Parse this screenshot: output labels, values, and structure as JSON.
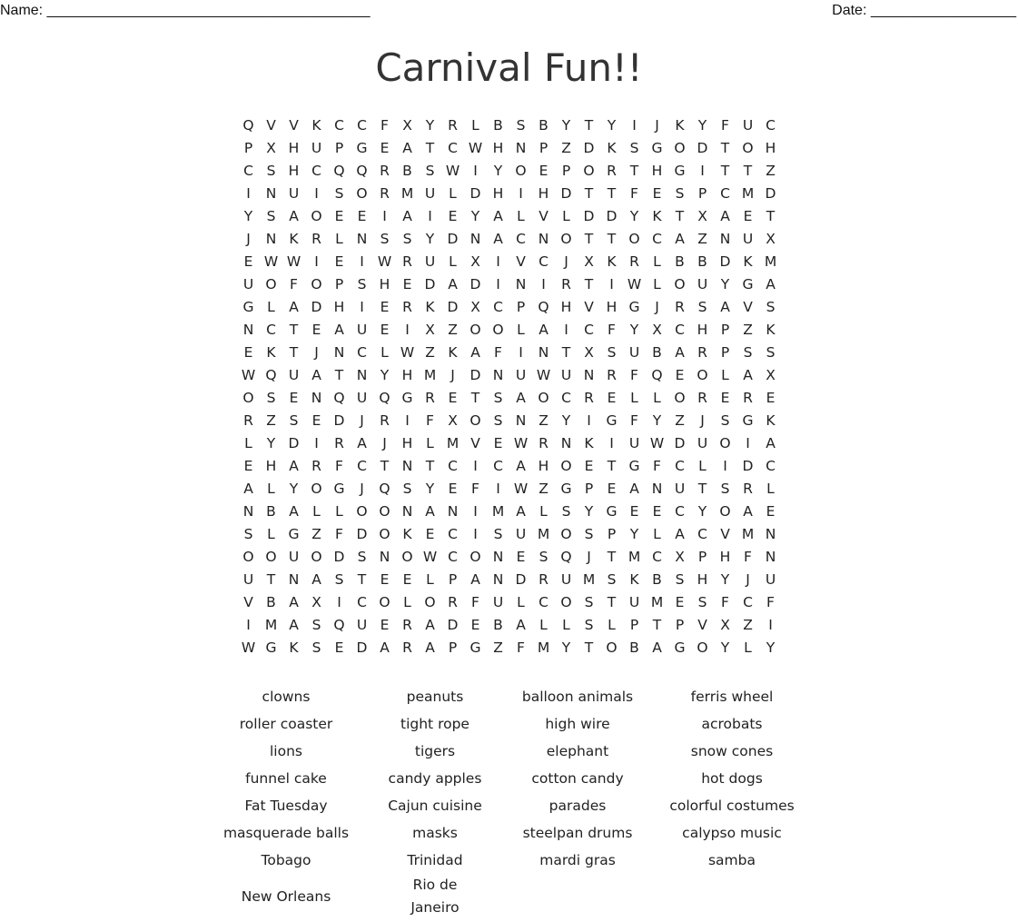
{
  "header": {
    "name_label": "Name: ________________________________________",
    "date_label": "Date: __________________"
  },
  "title": "Carnival Fun!!",
  "grid": [
    "QVVKCCFXYRLBSBYTYIJKYFUC",
    "PXHUPGEATCWHNPZDKSGODTOH",
    "CSHCQQRBSWIYOEPORTHGITTZ",
    "INUISORMULDHIHDTTFESPCMD",
    "YSAOEEIAIEYALVLDDYKTXAET",
    "JNKRLNSSYDNACNOTTOCAZNUX",
    "EWWIEIWRULXIVCJXKRLBBDKM",
    "UOFOPSHEDADINIRTIWLOUYGA",
    "GLADHIERKDXCPQHVHGJRSAVS",
    "NCTEAUEIXZOOLAICFYXCHPZK",
    "EKTJNCLWZKAFINTXSUBARPSS",
    "WQUATNYHMJDNUWUNRFQEOLAX",
    "OSENQUQGRETSAOCRELLORERE",
    "RZSEDJRIFXOSNZYIGFYZJSGK",
    "LYDIRAJHLMVEWRNKIUWDUOIA",
    "EHARFCTNTCICAHOETGFCLIDC",
    "ALYOGJQSYEFIWZGPEANUTSRL",
    "NBALLOONANIMALSYGEECYOAE",
    "SLGZFDOKECISUMOSPYLACVMN",
    "OOUODSNOWCONESQJTMCXPHFN",
    "UTNASTEELPANDRUMSKBSHYJU",
    "VBAXICOLORFULCOSTUMESFCF",
    "IMASQUERADEBALLSLPTPVXZI",
    "WGKSEDARAPGZFMYTOBAGOYLY"
  ],
  "word_rows": [
    [
      "clowns",
      "peanuts",
      "balloon animals",
      "ferris wheel"
    ],
    [
      "roller coaster",
      "tight rope",
      "high wire",
      "acrobats"
    ],
    [
      "lions",
      "tigers",
      "elephant",
      "snow cones"
    ],
    [
      "funnel cake",
      "candy apples",
      "cotton candy",
      "hot dogs"
    ],
    [
      "Fat Tuesday",
      "Cajun cuisine",
      "parades",
      "colorful costumes"
    ],
    [
      "masquerade balls",
      "masks",
      "steelpan drums",
      "calypso music"
    ],
    [
      "Tobago",
      "Trinidad",
      "mardi gras",
      "samba"
    ],
    [
      "New Orleans",
      "Rio de\nJaneiro",
      "",
      ""
    ]
  ]
}
